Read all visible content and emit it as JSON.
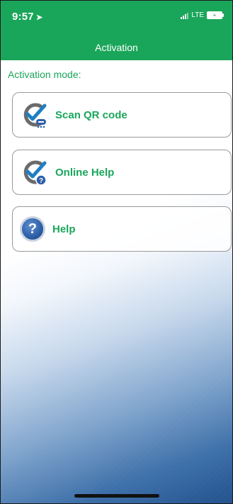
{
  "status_bar": {
    "time": "9:57",
    "carrier": "LTE",
    "battery": "+"
  },
  "header": {
    "title": "Activation"
  },
  "section": {
    "label": "Activation mode:"
  },
  "options": [
    {
      "label": "Scan QR code",
      "icon": "scan-qr-check-icon"
    },
    {
      "label": "Online Help",
      "icon": "online-help-check-icon"
    },
    {
      "label": "Help",
      "icon": "help-question-icon",
      "glyph": "?"
    }
  ],
  "colors": {
    "accent": "#1aa65a",
    "gradient_blue": "#1f4f8c"
  }
}
